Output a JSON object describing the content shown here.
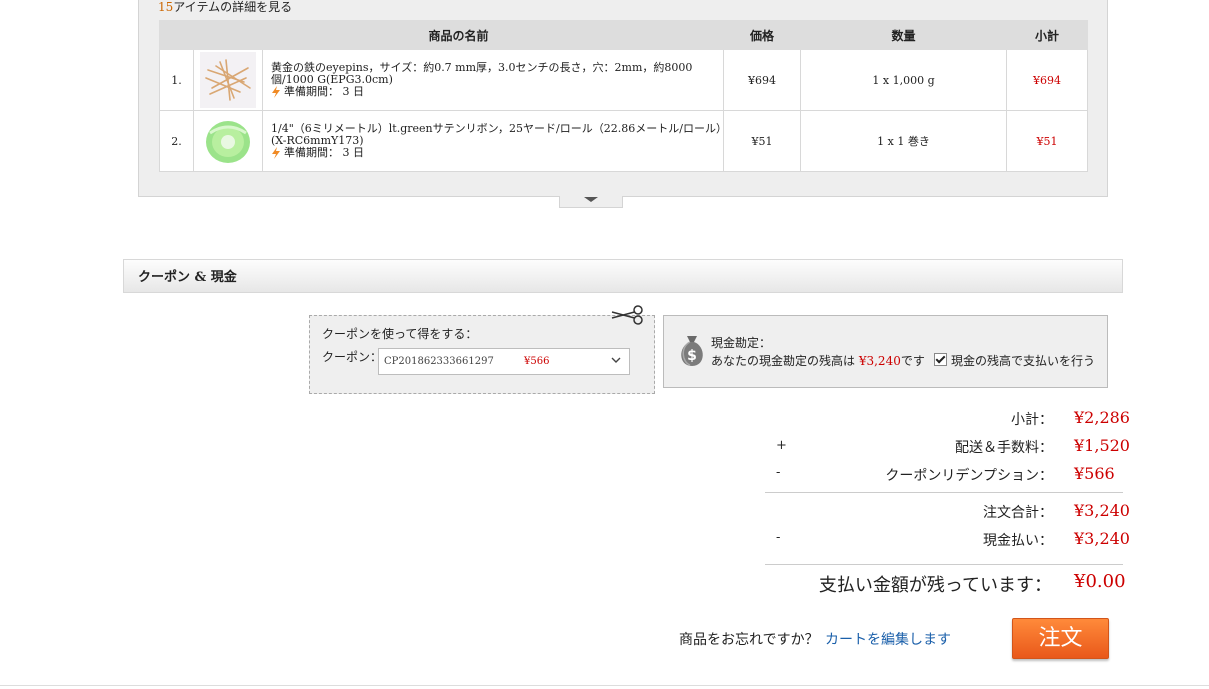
{
  "order_summary": {
    "view_count": "15",
    "view_link_text": "アイテムの詳細を見る",
    "columns": {
      "name": "商品の名前",
      "price": "価格",
      "quantity": "数量",
      "subtotal": "小計"
    },
    "items": [
      {
        "no": "1.",
        "name": "黄金の鉄のeyepins，サイズ：約0.7 mm厚，3.0センチの長さ，穴：2mm，約8000個/1000 G(EPG3.0cm)",
        "prep": "準備期間： 3 日",
        "price": "¥694",
        "quantity": "1 x 1,000 g",
        "subtotal": "¥694"
      },
      {
        "no": "2.",
        "name": "1/4\"（6ミリメートル）lt.greenサテンリボン，25ヤード/ロール（22.86メートル/ロール）(X-RC6mmY173)",
        "prep": "準備期間： 3 日",
        "price": "¥51",
        "quantity": "1 x 1 巻き",
        "subtotal": "¥51"
      }
    ]
  },
  "coupon_section": {
    "title": "クーポン & 現金",
    "use_coupon_label": "クーポンを使って得をする：",
    "coupon_label": "クーポン：",
    "coupon_code": "CP2018623336612​97",
    "coupon_amount": "¥566"
  },
  "cash_account": {
    "title": "現金勘定：",
    "balance_prefix": "あなたの現金勘定の残高は",
    "balance": "¥3,240",
    "balance_suffix": "です",
    "pay_with_balance_label": "現金の残高で支払いを行う",
    "pay_with_balance_checked": true
  },
  "totals": {
    "subtotal_label": "小計：",
    "subtotal_value": "¥2,286",
    "shipping_sign": "+",
    "shipping_label": "配送＆手数料：",
    "shipping_value": "¥1,520",
    "coupon_sign": "-",
    "coupon_label": "クーポンリデンプション：",
    "coupon_value": "¥566",
    "order_total_label": "注文合計：",
    "order_total_value": "¥3,240",
    "cash_sign": "-",
    "cash_label": "現金払い：",
    "cash_value": "¥3,240",
    "remaining_label": "支払い金額が残っています：",
    "remaining_value": "¥0.00"
  },
  "footer": {
    "forgot_text": "商品をお忘れですか？",
    "edit_cart_link": "カートを編集します",
    "order_button": "注文"
  },
  "colors": {
    "price_red": "#cc0000",
    "link_blue": "#1a5faa",
    "order_button": "#f07a2e"
  },
  "icons": [
    "scissors-icon",
    "money-bag-icon",
    "lightning-icon",
    "chevron-down-icon",
    "collapse-arrow-icon"
  ]
}
